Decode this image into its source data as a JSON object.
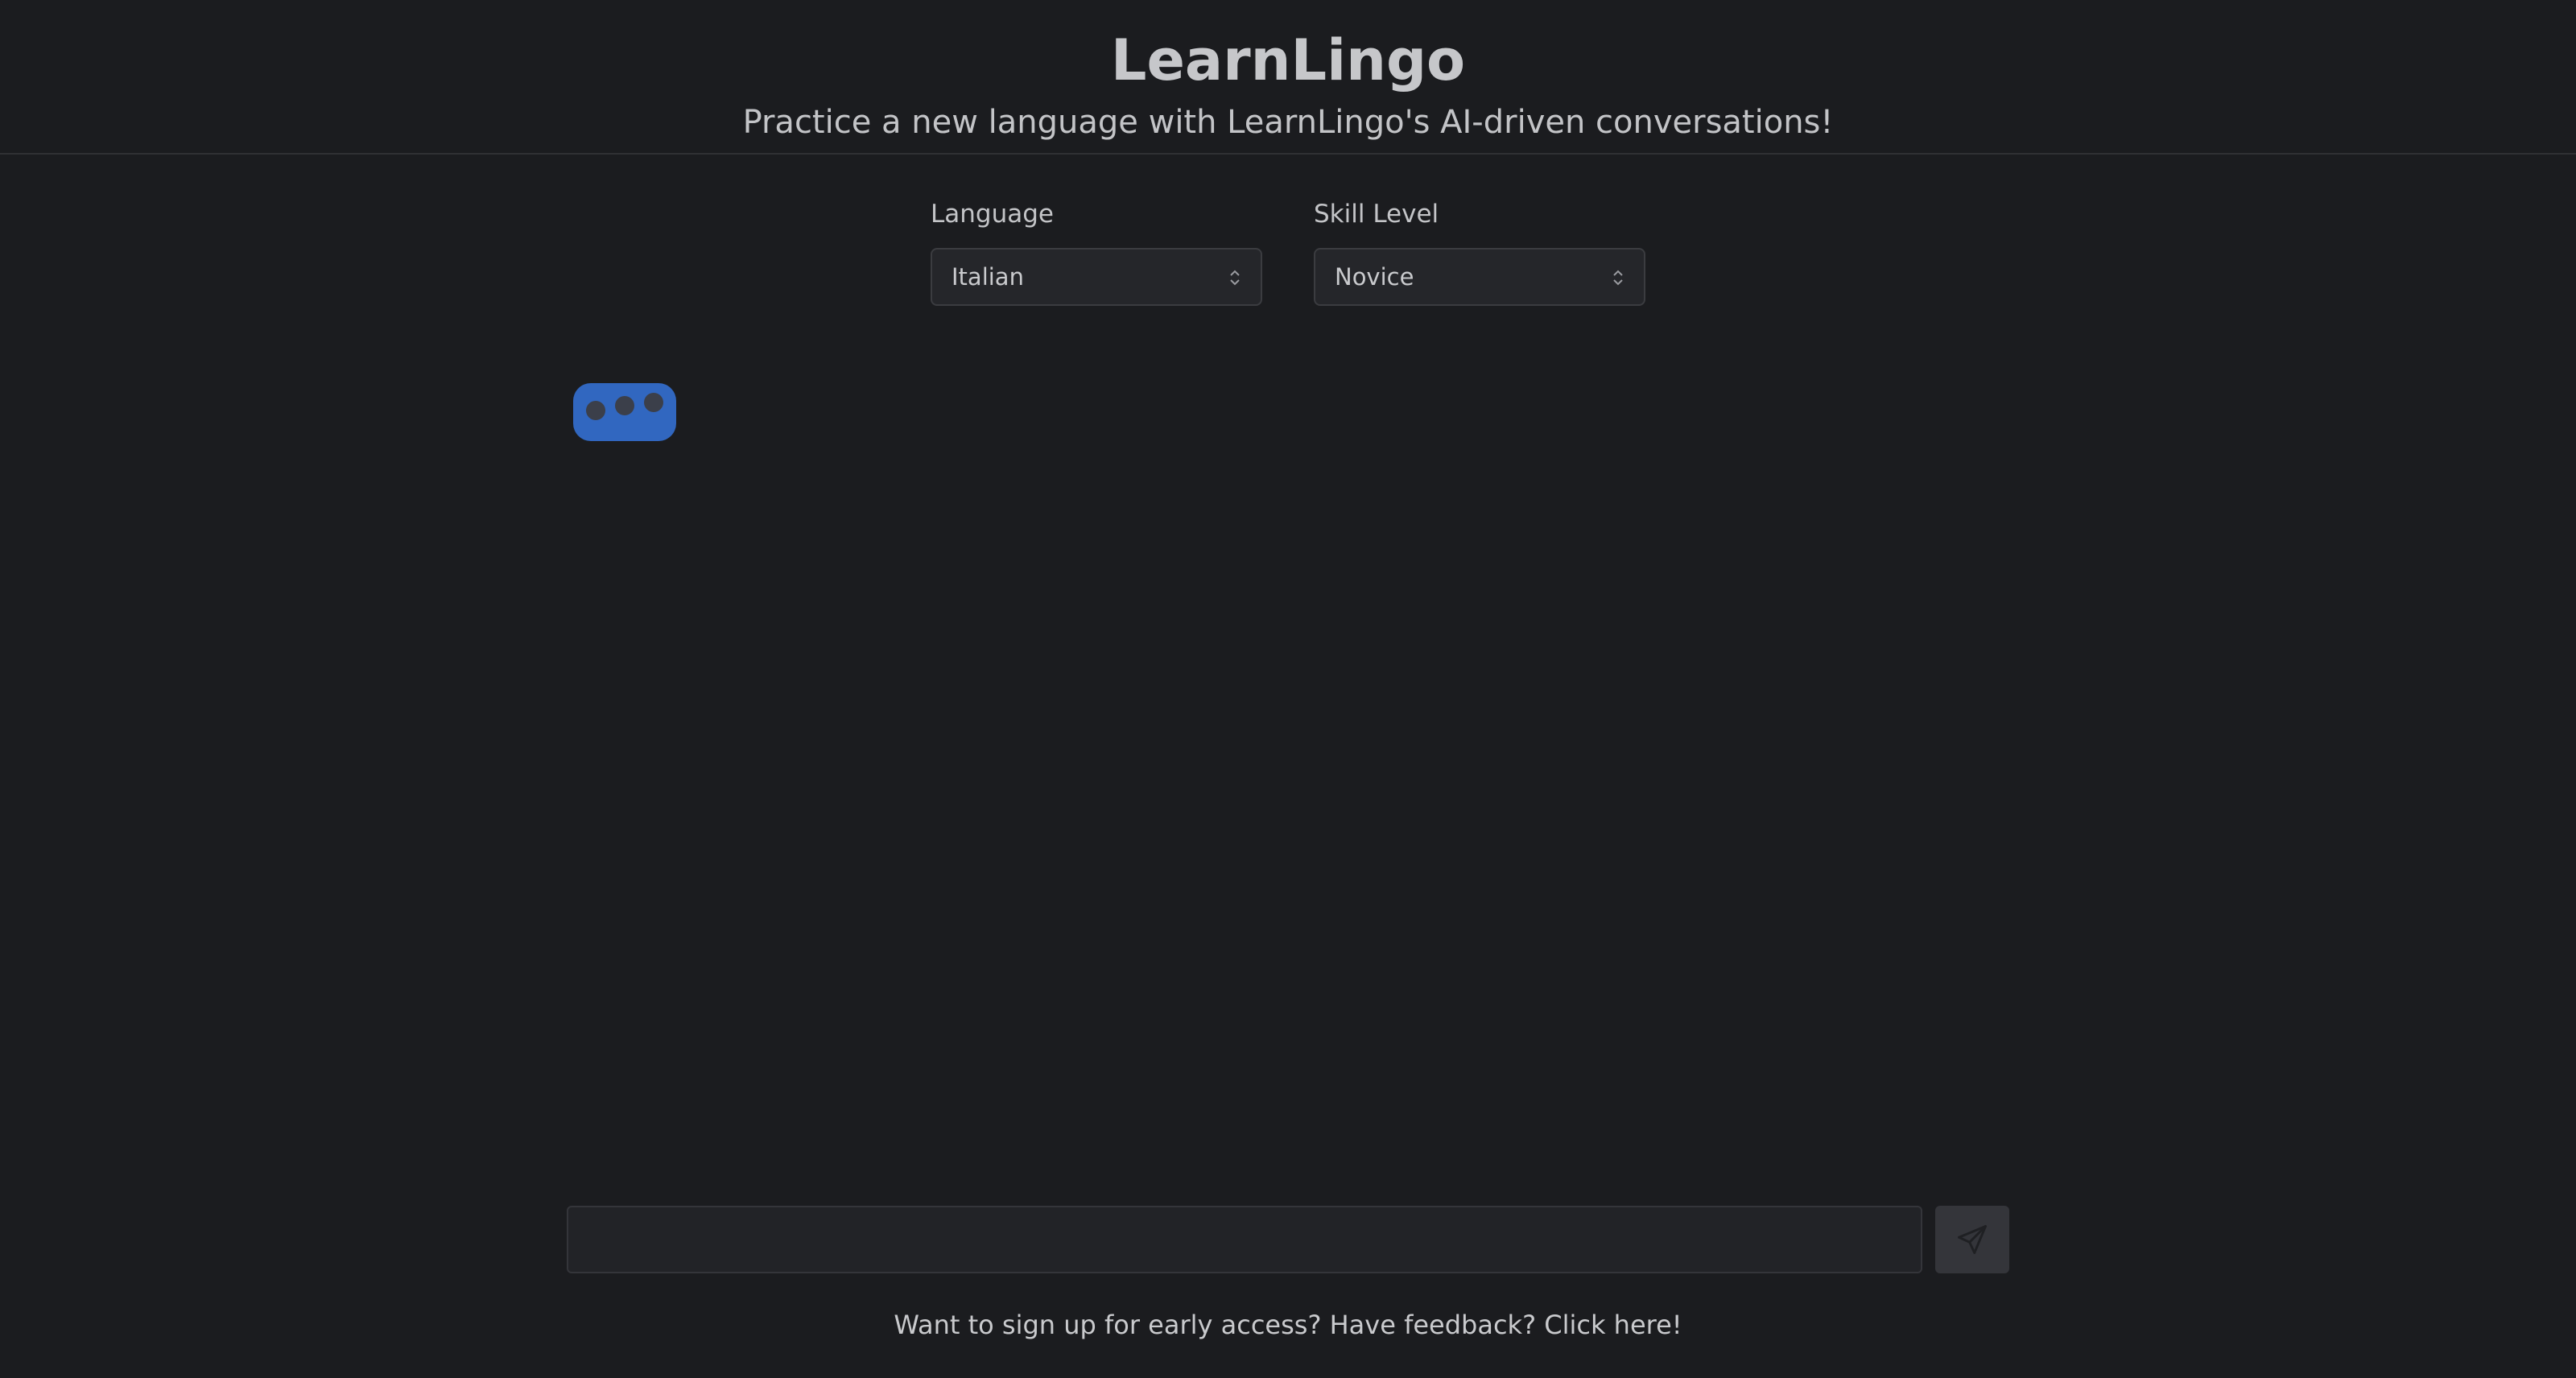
{
  "header": {
    "title": "LearnLingo",
    "subtitle": "Practice a new language with LearnLingo's AI-driven conversations!"
  },
  "settings": {
    "language": {
      "label": "Language",
      "selected": "Italian"
    },
    "skill_level": {
      "label": "Skill Level",
      "selected": "Novice"
    }
  },
  "chat": {
    "typing_indicator": {
      "icon": "typing-dots-icon",
      "color": "#3167c0"
    }
  },
  "composer": {
    "input_value": "",
    "send_icon": "paper-plane-icon"
  },
  "footer": {
    "link_text": "Want to sign up for early access? Have feedback? Click here!"
  },
  "colors": {
    "background": "#1b1c1f",
    "accent": "#3167c0"
  }
}
